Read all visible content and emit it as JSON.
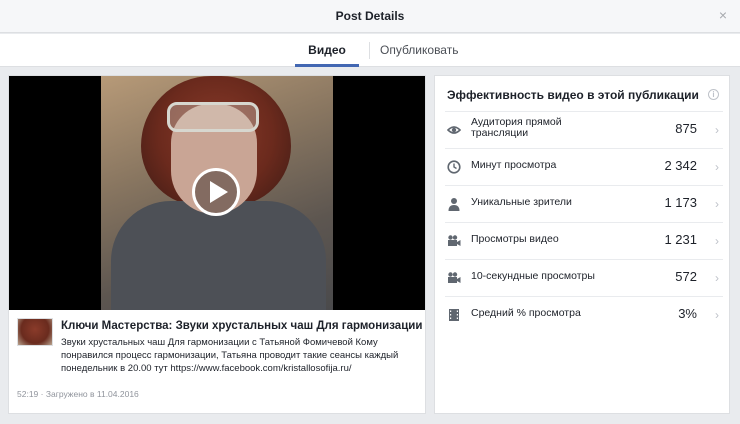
{
  "header": {
    "title": "Post Details",
    "close_symbol": "×"
  },
  "tabs": [
    {
      "label": "Видео",
      "active": true
    },
    {
      "label": "Опубликовать",
      "active": false
    }
  ],
  "post": {
    "title": "Ключи Мастерства: Звуки хрустальных чаш Для гармонизации",
    "description": "Звуки хрустальных чаш Для гармонизации с Татьяной Фомичевой Кому понравился процесс гармонизации, Татьяна проводит такие сеансы каждый понедельник в 20.00 тут https://www.facebook.com/kristallosofija.ru/",
    "duration": "52:19",
    "uploaded": "Загружено в 11.04.2016"
  },
  "performance": {
    "title": "Эффективность видео в этой публикации",
    "info_symbol": "i",
    "metrics": [
      {
        "label": "Аудитория прямой трансляции",
        "value": "875",
        "icon": "eye-icon"
      },
      {
        "label": "Минут просмотра",
        "value": "2 342",
        "icon": "clock-icon"
      },
      {
        "label": "Уникальные зрители",
        "value": "1 173",
        "icon": "person-icon"
      },
      {
        "label": "Просмотры видео",
        "value": "1 231",
        "icon": "camera-icon"
      },
      {
        "label": "10-секундные просмотры",
        "value": "572",
        "icon": "camera-icon"
      },
      {
        "label": "Средний % просмотра",
        "value": "3%",
        "icon": "film-icon"
      }
    ]
  },
  "colors": {
    "accent": "#4267b2",
    "icon": "#606770",
    "chevron": "#bec2c9"
  }
}
